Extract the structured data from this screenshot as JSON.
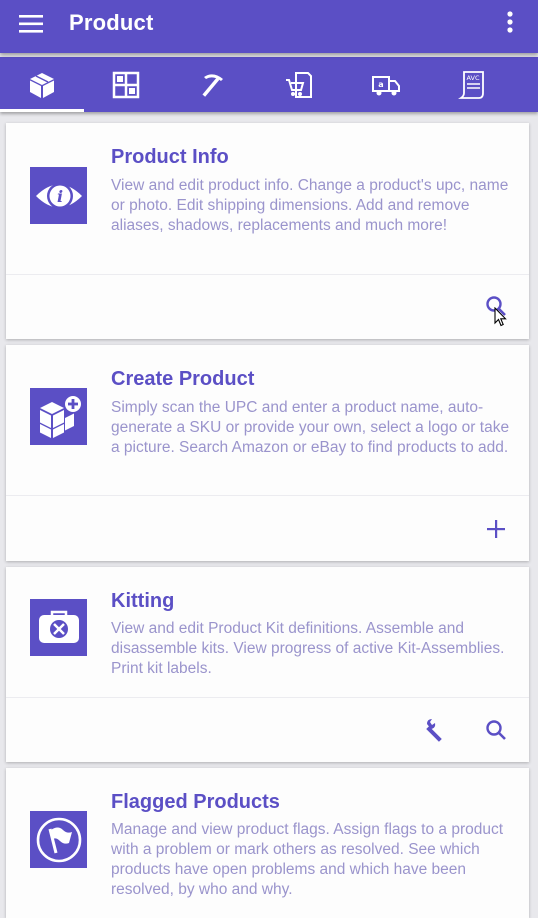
{
  "appbar": {
    "title": "Product",
    "menu_icon": "hamburger-menu-icon",
    "more_icon": "more-vert-icon"
  },
  "tabs": [
    {
      "icon": "box-icon",
      "selected": true
    },
    {
      "icon": "shelving-icon",
      "selected": false
    },
    {
      "icon": "pickaxe-icon",
      "selected": false
    },
    {
      "icon": "cart-document-icon",
      "selected": false
    },
    {
      "icon": "amazon-truck-icon",
      "selected": false
    },
    {
      "icon": "avc-scroll-icon",
      "selected": false
    }
  ],
  "cards": [
    {
      "title": "Product Info",
      "description": "View and edit product info. Change a product's upc, name or photo. Edit shipping dimensions. Add and remove aliases, shadows, replacements and much more!",
      "icon": "info-icon",
      "actions": [
        "search-icon"
      ]
    },
    {
      "title": "Create Product",
      "description": "Simply scan the UPC and enter a product name, auto-generate a SKU or provide your own, select a logo or take a picture. Search Amazon or eBay to find products to add.",
      "icon": "boxes-plus-icon",
      "actions": [
        "add-icon"
      ]
    },
    {
      "title": "Kitting",
      "description": "View and edit Product Kit definitions. Assemble and disassemble kits. View progress of active Kit-Assemblies. Print kit labels.",
      "icon": "toolkit-icon",
      "actions": [
        "wrench-icon",
        "search-icon"
      ]
    },
    {
      "title": "Flagged Products",
      "description": "Manage and view product flags. Assign flags to a product with a problem or mark others as resolved. See which products have open problems and which have been resolved, by who and why.",
      "icon": "flag-icon",
      "actions": []
    }
  ],
  "colors": {
    "primary": "#5b4fc5",
    "description_text": "#9a94cc",
    "card_bg": "#fdfdfd",
    "page_bg": "#e8e8ec"
  }
}
